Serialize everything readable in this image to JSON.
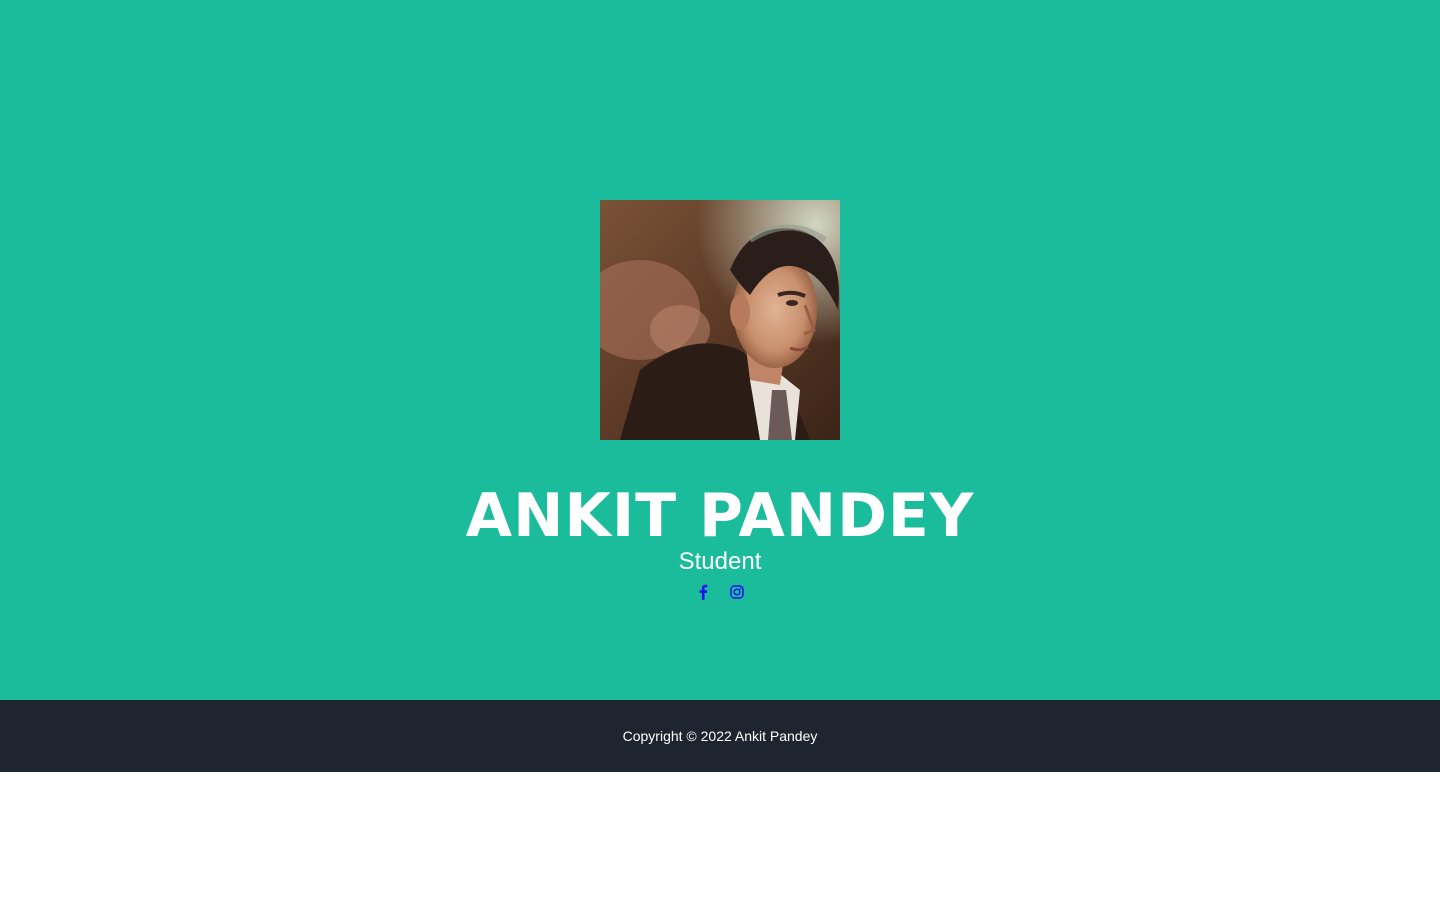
{
  "profile": {
    "name": "ANKIT PANDEY",
    "subtitle": "Student",
    "photo_alt": "Profile photo"
  },
  "social": [
    {
      "icon": "facebook-icon",
      "label": "Facebook"
    },
    {
      "icon": "instagram-icon",
      "label": "Instagram"
    }
  ],
  "footer": {
    "copyright": "Copyright © 2022 Ankit Pandey"
  },
  "colors": {
    "masthead_bg": "#1abc9c",
    "footer_bg": "#1e2530",
    "text": "#ffffff",
    "social_icon": "#1a12f5"
  }
}
